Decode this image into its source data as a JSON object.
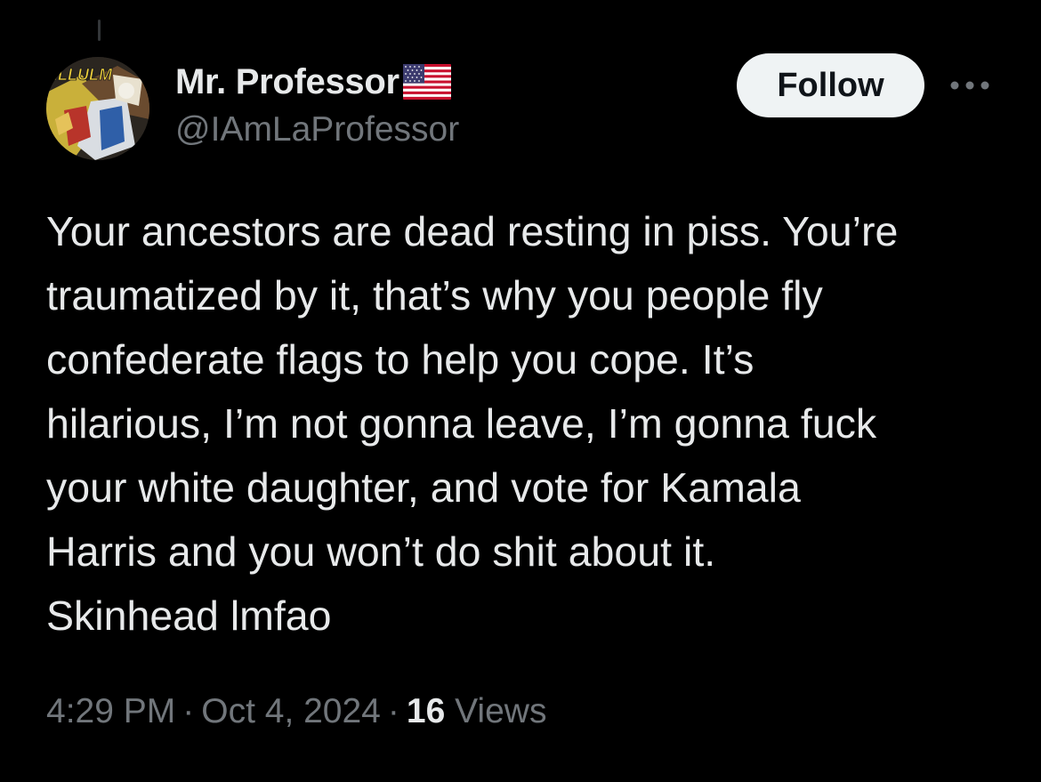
{
  "author": {
    "display_name": "Mr. Professor",
    "badge_icon": "us-flag-icon",
    "handle": "@IAmLaProfessor",
    "avatar_text": "ILLULM"
  },
  "actions": {
    "follow_label": "Follow",
    "more_icon": "more-horizontal-icon"
  },
  "tweet": {
    "lines": [
      "Your ancestors are dead resting in piss. You’re",
      "traumatized by it, that’s why you people fly",
      "confederate flags to help you cope. It’s",
      "hilarious, I’m not gonna leave, I’m gonna fuck",
      "your white daughter, and vote for Kamala",
      "Harris and you won’t do shit about it.",
      "Skinhead lmfao"
    ]
  },
  "meta": {
    "time": "4:29 PM",
    "date": "Oct 4, 2024",
    "separator": "·",
    "views_count": "16",
    "views_label": "Views"
  },
  "colors": {
    "background": "#000000",
    "primary_text": "#e7e9ea",
    "secondary_text": "#71767b",
    "follow_bg": "#eff3f4",
    "follow_text": "#0f1419"
  }
}
